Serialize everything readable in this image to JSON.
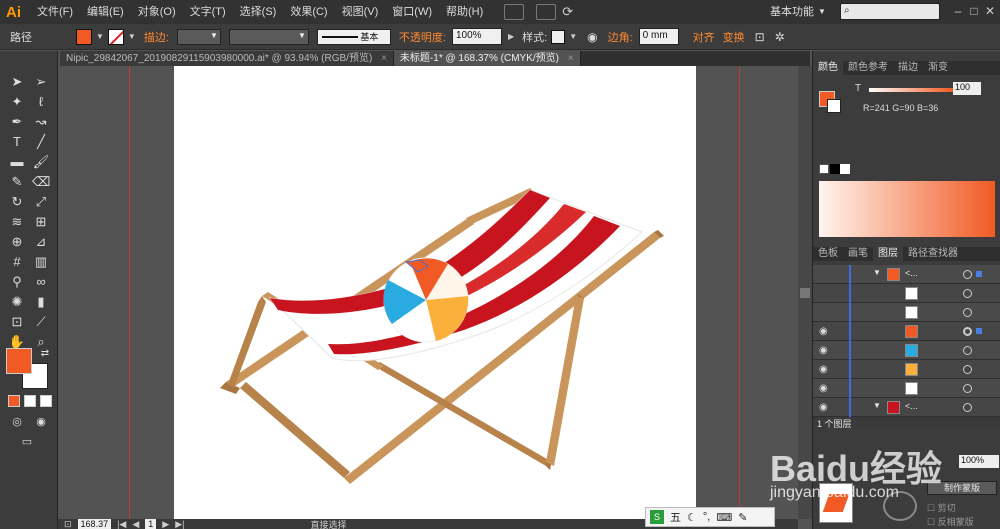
{
  "app": {
    "logo": "Ai"
  },
  "menu": [
    "文件(F)",
    "编辑(E)",
    "对象(O)",
    "文字(T)",
    "选择(S)",
    "效果(C)",
    "视图(V)",
    "窗口(W)",
    "帮助(H)"
  ],
  "workspace_label": "基本功能",
  "control": {
    "selection_label": "路径",
    "stroke_label": "描边:",
    "stroke_style": "基本",
    "opacity_label": "不透明度:",
    "opacity_value": "100%",
    "style_label": "样式:",
    "corner_label": "边角:",
    "corner_value": "0 mm",
    "align_label": "对齐",
    "transform_label": "变换"
  },
  "tabs": [
    {
      "label": "Nipic_29842067_20190829115903980000.ai* @ 93.94% (RGB/预览)",
      "active": false
    },
    {
      "label": "未标题-1* @ 168.37% (CMYK/预览)",
      "active": true
    }
  ],
  "color_panel": {
    "tabs": [
      "颜色",
      "颜色参考",
      "描边",
      "渐变"
    ],
    "t_label": "T",
    "t_value": "100",
    "rgb_readout": "R=241 G=90 B=36",
    "fill_color": "#f15a24"
  },
  "layers_panel": {
    "tabs": [
      "色板",
      "画笔",
      "图层",
      "路径查找器"
    ],
    "footer_count": "1 个图层",
    "rows": [
      {
        "eye": "",
        "expand": "▼",
        "name": "<...",
        "indent": 0
      },
      {
        "eye": "",
        "expand": "",
        "name": "",
        "indent": 1
      },
      {
        "eye": "",
        "expand": "",
        "name": "",
        "indent": 1
      },
      {
        "eye": "◉",
        "expand": "",
        "name": "",
        "indent": 1
      },
      {
        "eye": "◉",
        "expand": "",
        "name": "",
        "indent": 1
      },
      {
        "eye": "◉",
        "expand": "",
        "name": "",
        "indent": 1
      },
      {
        "eye": "◉",
        "expand": "",
        "name": "",
        "indent": 1
      },
      {
        "eye": "◉",
        "expand": "▼",
        "name": "<...",
        "indent": 0
      },
      {
        "eye": "◉",
        "expand": "▼",
        "name": "",
        "indent": 1
      }
    ]
  },
  "appearance_panel": {
    "opacity_value": "100%",
    "make_mask_label": "制作蒙版",
    "clip_label": "剪切",
    "invert_label": "反相蒙版"
  },
  "status": {
    "zoom": "168.37",
    "page": "1",
    "tool_name": "直接选择"
  },
  "watermark": {
    "brand": "Baidu经验",
    "url": "jingyan.baidu.com"
  },
  "ime_bar": {
    "label": "五"
  }
}
